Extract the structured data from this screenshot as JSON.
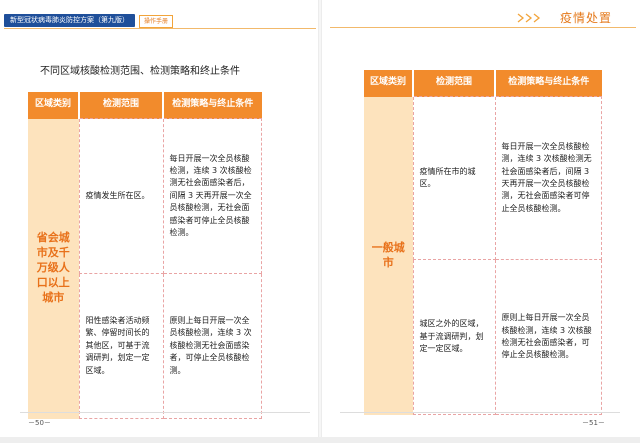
{
  "left": {
    "header_title": "新型冠状病毒肺炎防控方案（第九版）",
    "header_tag": "操作手册",
    "caption": "不同区域核酸检测范围、检测策略和终止条件",
    "table": {
      "headers": [
        "区域类别",
        "检测范围",
        "检测策略与终止条件"
      ],
      "category": "省会城市及千万级人口以上城市",
      "rows": [
        {
          "scope": "疫情发生所在区。",
          "strategy": "每日开展一次全员核酸检测，连续 3 次核酸检测无社会面感染者后，间隔 3 天再开展一次全员核酸检测，无社会面感染者可停止全员核酸检测。"
        },
        {
          "scope": "阳性感染者活动频繁、停留时间长的其他区，可基于流调研判，划定一定区域。",
          "strategy": "原则上每日开展一次全员核酸检测，连续 3 次核酸检测无社会面感染者，可停止全员核酸检测。"
        }
      ]
    },
    "page_number": "－50－"
  },
  "right": {
    "section_title": "疫情处置",
    "table": {
      "headers": [
        "区域类别",
        "检测范围",
        "检测策略与终止条件"
      ],
      "category": "一般城市",
      "rows": [
        {
          "scope": "疫情所在市的城区。",
          "strategy": "每日开展一次全员核酸检测，连续 3 次核酸检测无社会面感染者后，间隔 3 天再开展一次全员核酸检测，无社会面感染者可停止全员核酸检测。"
        },
        {
          "scope": "城区之外的区域，基于流调研判，划定一定区域。",
          "strategy": "原则上每日开展一次全员核酸检测，连续 3 次核酸检测无社会面感染者，可停止全员核酸检测。"
        }
      ]
    },
    "page_number": "－51－"
  },
  "colors": {
    "accent_orange": "#f28b2c",
    "category_fill": "#fde3bd",
    "category_text": "#e8711a",
    "header_blue": "#1f4f9a"
  }
}
